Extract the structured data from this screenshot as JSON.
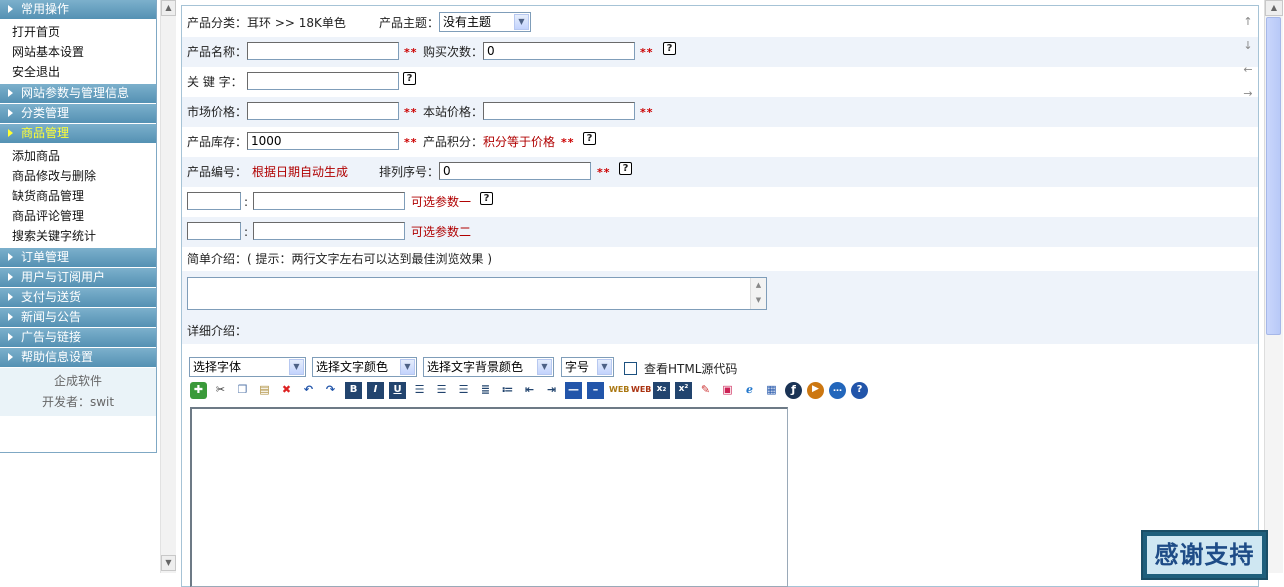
{
  "sidebar": {
    "groups": [
      {
        "title": "常用操作",
        "items": [
          "打开首页",
          "网站基本设置",
          "安全退出"
        ]
      },
      {
        "title": "网站参数与管理信息",
        "items": []
      },
      {
        "title": "分类管理",
        "items": []
      },
      {
        "title": "商品管理",
        "items": [
          "添加商品",
          "商品修改与删除",
          "缺货商品管理",
          "商品评论管理",
          "搜索关键字统计"
        ]
      },
      {
        "title": "订单管理",
        "items": []
      },
      {
        "title": "用户与订阅用户",
        "items": []
      },
      {
        "title": "支付与送货",
        "items": []
      },
      {
        "title": "新闻与公告",
        "items": []
      },
      {
        "title": "广告与链接",
        "items": []
      },
      {
        "title": "帮助信息设置",
        "items": []
      }
    ],
    "footer": {
      "company": "企成软件",
      "developer": "开发者：swit"
    }
  },
  "form": {
    "category_label": "产品分类：",
    "category_value": "耳环 >> 18K单色",
    "theme_label": "产品主题：",
    "theme_value": "没有主题",
    "name_label": "产品名称：",
    "name_value": "",
    "buy_count_label": "购买次数：",
    "buy_count_value": "0",
    "keyword_label": "关 键 字：",
    "keyword_value": "",
    "market_price_label": "市场价格：",
    "market_price_value": "",
    "site_price_label": "本站价格：",
    "site_price_value": "",
    "stock_label": "产品库存：",
    "stock_value": "1000",
    "points_label": "产品积分：",
    "points_value": "积分等于价格",
    "code_label": "产品编号：",
    "code_value": "根据日期自动生成",
    "sort_label": "排列序号：",
    "sort_value": "0",
    "param1_label": "可选参数一",
    "param2_label": "可选参数二",
    "param_sep": ":",
    "brief_label": "简单介绍：( 提示：两行文字左右可以达到最佳浏览效果 )",
    "detail_label": "详细介绍：",
    "required_mark": "**",
    "help_mark": "?"
  },
  "editor": {
    "font_select": "选择字体",
    "color_select": "选择文字颜色",
    "bgcolor_select": "选择文字背景颜色",
    "size_select": "字号",
    "source_checkbox": "查看HTML源代码",
    "tools": [
      "new-doc",
      "cut",
      "copy",
      "paste",
      "delete",
      "undo",
      "redo",
      "bold",
      "italic",
      "underline",
      "align-left",
      "align-center",
      "align-right",
      "ordered-list",
      "unordered-list",
      "outdent",
      "indent",
      "hr",
      "hr-thin",
      "web-image",
      "web-flash",
      "subscript",
      "superscript",
      "brush",
      "image",
      "link",
      "table",
      "flash",
      "media",
      "comment",
      "help"
    ]
  },
  "nav_arrows": [
    "↑",
    "↓",
    "←",
    "→"
  ],
  "badge": {
    "text": "感谢支持"
  }
}
